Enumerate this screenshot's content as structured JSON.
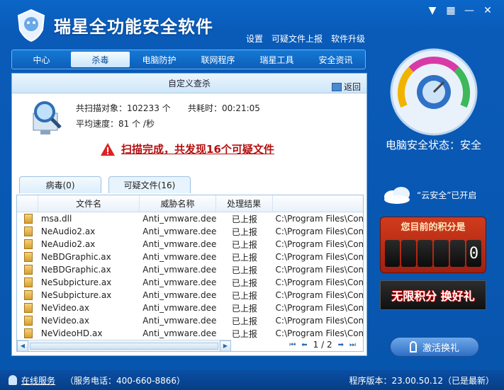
{
  "app": {
    "title": "瑞星全功能安全软件"
  },
  "window": {
    "skin_icon": "skin-icon",
    "min_icon": "minimize-icon",
    "close_icon": "close-icon"
  },
  "toplinks": [
    "设置",
    "可疑文件上报",
    "软件升级"
  ],
  "tabs": [
    "中心",
    "杀毒",
    "电脑防护",
    "联网程序",
    "瑞星工具",
    "安全资讯"
  ],
  "active_tab": "杀毒",
  "panel": {
    "title": "自定义查杀",
    "back_label": "返回",
    "scanned_label": "共扫描对象：",
    "scanned_value": "102233 个",
    "time_label": "共耗时：",
    "time_value": "00:21:05",
    "speed_label": "平均速度：",
    "speed_value": "81 个 /秒",
    "result_text": "扫描完成，共发现16个可疑文件"
  },
  "subtabs": [
    "病毒(0)",
    "可疑文件(16)"
  ],
  "table": {
    "headers": [
      "文件名",
      "威胁名称",
      "处理结果"
    ],
    "rows": [
      [
        "msa.dll",
        "Anti_vmware.deep",
        "已上报",
        "C:\\Program Files\\Com"
      ],
      [
        "NeAudio2.ax",
        "Anti_vmware.deep",
        "已上报",
        "C:\\Program Files\\Com"
      ],
      [
        "NeAudio2.ax",
        "Anti_vmware.deep",
        "已上报",
        "C:\\Program Files\\Com"
      ],
      [
        "NeBDGraphic.ax",
        "Anti_vmware.deep",
        "已上报",
        "C:\\Program Files\\Com"
      ],
      [
        "NeBDGraphic.ax",
        "Anti_vmware.deep",
        "已上报",
        "C:\\Program Files\\Com"
      ],
      [
        "NeSubpicture.ax",
        "Anti_vmware.deep",
        "已上报",
        "C:\\Program Files\\Com"
      ],
      [
        "NeSubpicture.ax",
        "Anti_vmware.deep",
        "已上报",
        "C:\\Program Files\\Com"
      ],
      [
        "NeVideo.ax",
        "Anti_vmware.deep",
        "已上报",
        "C:\\Program Files\\Com"
      ],
      [
        "NeVideo.ax",
        "Anti_vmware.deep",
        "已上报",
        "C:\\Program Files\\Com"
      ],
      [
        "NeVideoHD.ax",
        "Anti_vmware.deep",
        "已上报",
        "C:\\Program Files\\Com"
      ]
    ]
  },
  "pager": {
    "text": "1 / 2"
  },
  "side": {
    "status": "电脑安全状态：安全",
    "cloud_text": "“云安全”已开启",
    "score_label": "您目前的积分是",
    "score_digits": [
      "",
      "",
      "",
      "",
      "",
      "0"
    ],
    "banner": "无限积分 换好礼",
    "redeem": "激活换礼"
  },
  "bottom": {
    "online": "在线服务",
    "phone": "（服务电话：400-660-8866）",
    "version": "程序版本：23.00.50.12（已是最新）"
  },
  "colors": {
    "accent": "#0a5bb8",
    "warn": "#b31010",
    "score": "#c03018"
  }
}
